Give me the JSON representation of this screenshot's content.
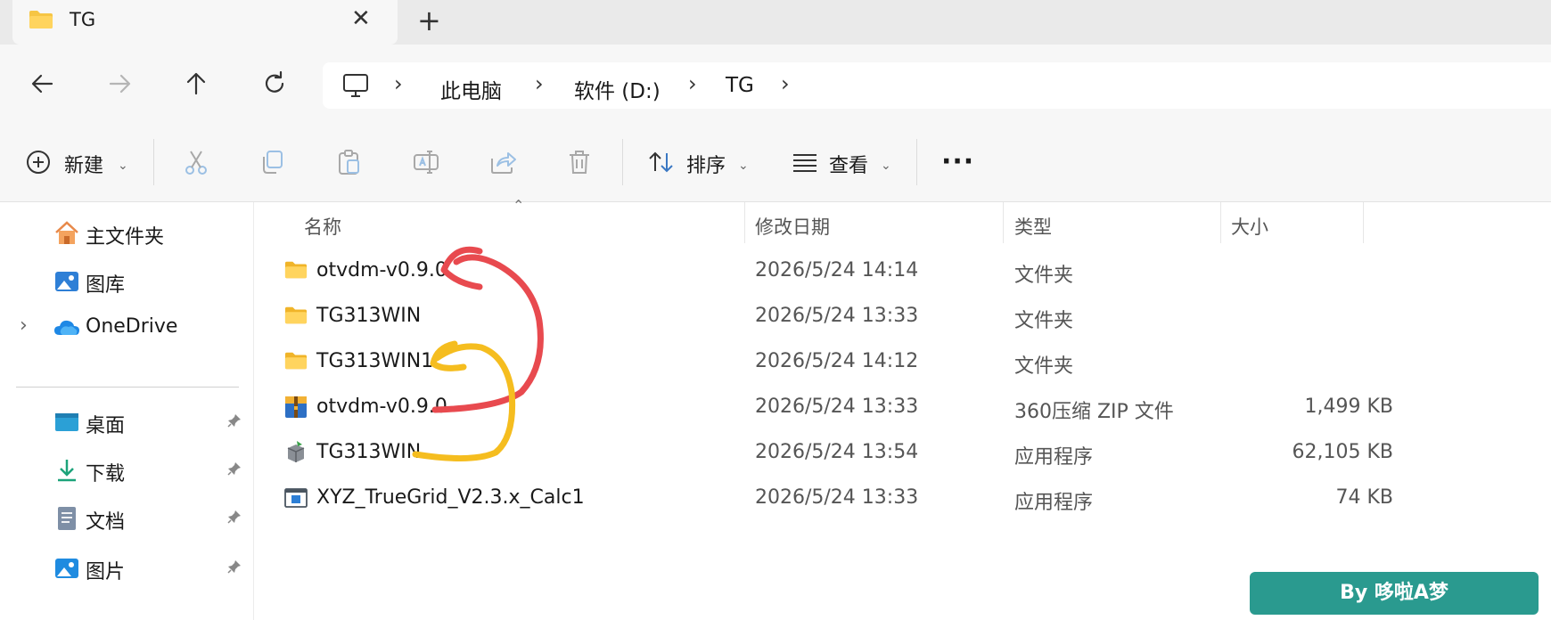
{
  "window": {
    "tab_title": "TG",
    "close_tab_glyph": "✕",
    "new_tab_glyph": "+"
  },
  "breadcrumb": {
    "items": [
      "此电脑",
      "软件 (D:)",
      "TG"
    ],
    "separator": "›"
  },
  "toolbar": {
    "new_label": "新建",
    "sort_label": "排序",
    "view_label": "查看",
    "more_glyph": "···"
  },
  "sidebar": {
    "items": [
      {
        "label": "主文件夹",
        "icon": "home-icon"
      },
      {
        "label": "图库",
        "icon": "gallery-icon"
      },
      {
        "label": "OneDrive",
        "icon": "cloud-icon"
      },
      {
        "label": "桌面",
        "icon": "desktop-icon"
      },
      {
        "label": "下载",
        "icon": "download-icon"
      },
      {
        "label": "文档",
        "icon": "document-icon"
      },
      {
        "label": "图片",
        "icon": "pictures-icon"
      }
    ]
  },
  "columns": {
    "name": "名称",
    "date": "修改日期",
    "type": "类型",
    "size": "大小"
  },
  "files": [
    {
      "name": "otvdm-v0.9.0",
      "date": "2026/5/24 14:14",
      "type": "文件夹",
      "size": "",
      "icon": "folder-icon"
    },
    {
      "name": "TG313WIN",
      "date": "2026/5/24 13:33",
      "type": "文件夹",
      "size": "",
      "icon": "folder-icon"
    },
    {
      "name": "TG313WIN1",
      "date": "2026/5/24 14:12",
      "type": "文件夹",
      "size": "",
      "icon": "folder-icon"
    },
    {
      "name": "otvdm-v0.9.0",
      "date": "2026/5/24 13:33",
      "type": "360压缩 ZIP 文件",
      "size": "1,499 KB",
      "icon": "zip-archive-icon"
    },
    {
      "name": "TG313WIN",
      "date": "2026/5/24 13:54",
      "type": "应用程序",
      "size": "62,105 KB",
      "icon": "installer-icon"
    },
    {
      "name": "XYZ_TrueGrid_V2.3.x_Calc1",
      "date": "2026/5/24 13:33",
      "type": "应用程序",
      "size": "74 KB",
      "icon": "application-icon"
    }
  ],
  "watermark": "By 哆啦A梦",
  "colors": {
    "red_annotation": "#e84a4f",
    "yellow_annotation": "#f5bd1f",
    "badge": "#2a9a8f",
    "folder": "#f6c544"
  }
}
